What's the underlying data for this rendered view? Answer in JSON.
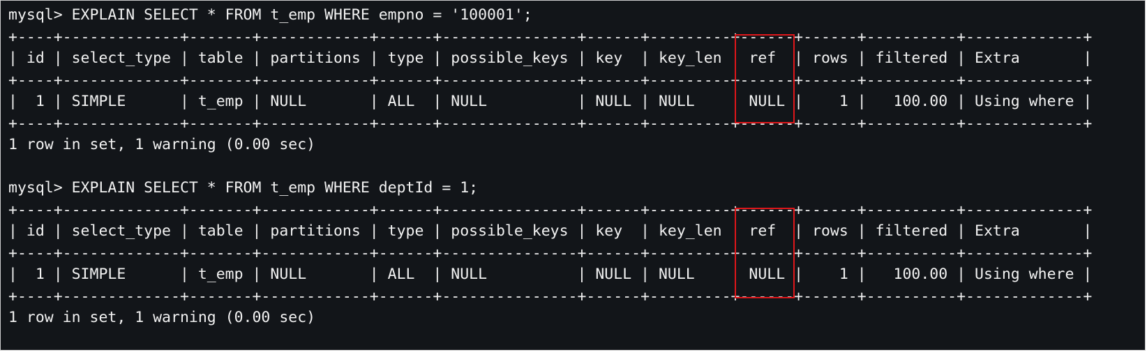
{
  "terminal": {
    "lines": [
      "mysql> EXPLAIN SELECT * FROM t_emp WHERE empno = '100001';",
      "+----+-------------+-------+------------+------+---------------+------+---------+------+------+----------+-------------+",
      "| id | select_type | table | partitions | type | possible_keys | key  | key_len | ref  | rows | filtered | Extra       |",
      "+----+-------------+-------+------------+------+---------------+------+---------+------+------+----------+-------------+",
      "|  1 | SIMPLE      | t_emp | NULL       | ALL  | NULL          | NULL | NULL    | NULL |    1 |   100.00 | Using where |",
      "+----+-------------+-------+------------+------+---------------+------+---------+------+------+----------+-------------+",
      "1 row in set, 1 warning (0.00 sec)",
      "",
      "mysql> EXPLAIN SELECT * FROM t_emp WHERE deptId = 1;",
      "+----+-------------+-------+------------+------+---------------+------+---------+------+------+----------+-------------+",
      "| id | select_type | table | partitions | type | possible_keys | key  | key_len | ref  | rows | filtered | Extra       |",
      "+----+-------------+-------+------------+------+---------------+------+---------+------+------+----------+-------------+",
      "|  1 | SIMPLE      | t_emp | NULL       | ALL  | NULL          | NULL | NULL    | NULL |    1 |   100.00 | Using where |",
      "+----+-------------+-------+------------+------+---------------+------+---------+------+------+----------+-------------+",
      "1 row in set, 1 warning (0.00 sec)"
    ]
  },
  "colors": {
    "background": "#121519",
    "text": "#f2f2f2",
    "highlight": "#e0161a"
  }
}
